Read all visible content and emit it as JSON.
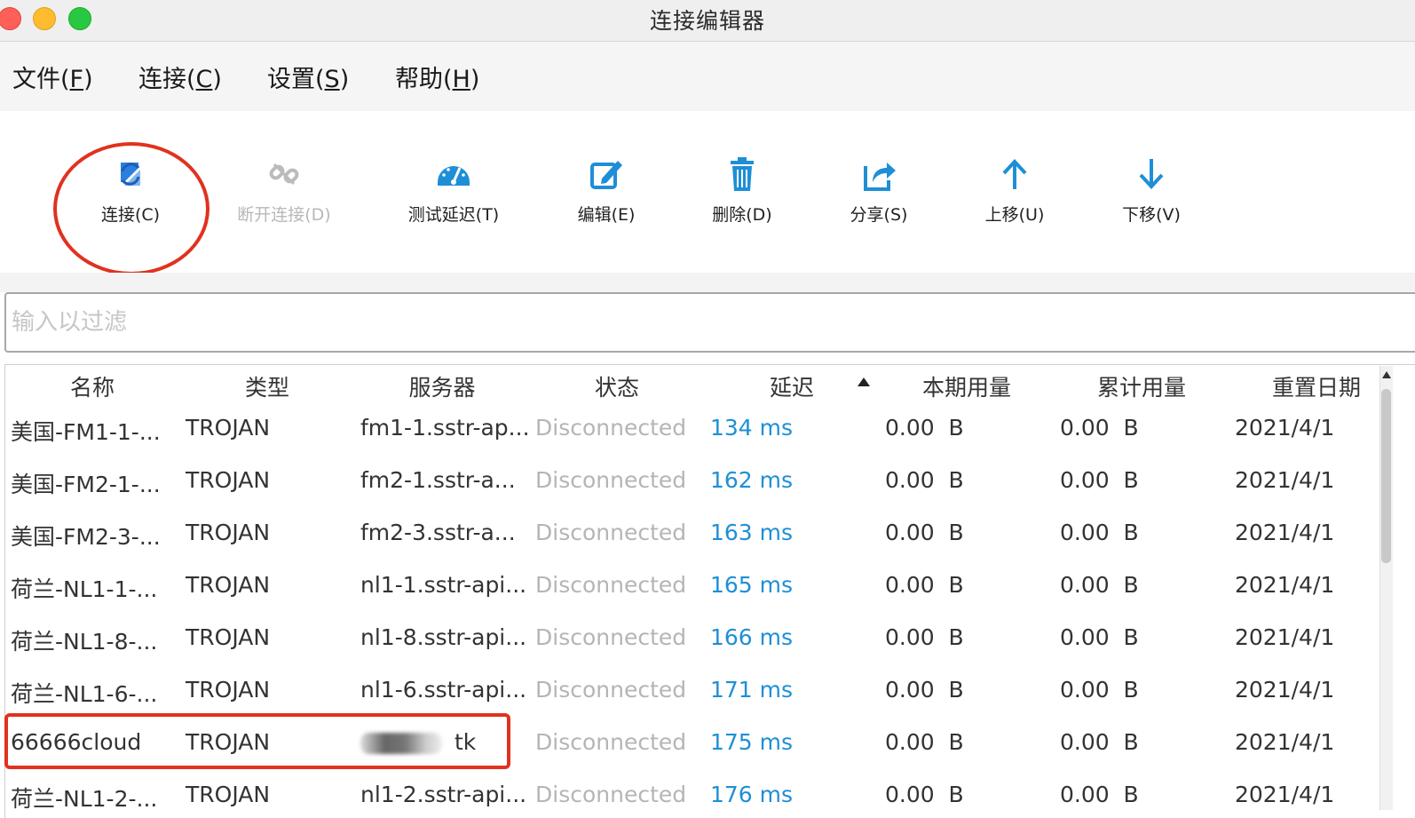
{
  "window": {
    "title": "连接编辑器"
  },
  "menu": [
    {
      "label": "文件(",
      "key": "F",
      "close": ")"
    },
    {
      "label": "连接(",
      "key": "C",
      "close": ")"
    },
    {
      "label": "设置(",
      "key": "S",
      "close": ")"
    },
    {
      "label": "帮助(",
      "key": "H",
      "close": ")"
    }
  ],
  "toolbar": {
    "connect": "连接(C)",
    "disconnect": "断开连接(D)",
    "test_latency": "测试延迟(T)",
    "edit": "编辑(E)",
    "delete": "删除(D)",
    "share": "分享(S)",
    "move_up": "上移(U)",
    "move_down": "下移(V)"
  },
  "filter": {
    "placeholder": "输入以过滤"
  },
  "table": {
    "columns": [
      "名称",
      "类型",
      "服务器",
      "状态",
      "延迟",
      "本期用量",
      "累计用量",
      "重置日期"
    ],
    "rows": [
      [
        "美国-FM1-1-...",
        "TROJAN",
        "fm1-1.sstr-ap...",
        "Disconnected",
        "134 ms",
        "0.00  B",
        "0.00  B",
        "2021/4/1"
      ],
      [
        "美国-FM2-1-...",
        "TROJAN",
        "fm2-1.sstr-a...",
        "Disconnected",
        "162 ms",
        "0.00  B",
        "0.00  B",
        "2021/4/1"
      ],
      [
        "美国-FM2-3-...",
        "TROJAN",
        "fm2-3.sstr-a...",
        "Disconnected",
        "163 ms",
        "0.00  B",
        "0.00  B",
        "2021/4/1"
      ],
      [
        "荷兰-NL1-1-...",
        "TROJAN",
        "nl1-1.sstr-api...",
        "Disconnected",
        "165 ms",
        "0.00  B",
        "0.00  B",
        "2021/4/1"
      ],
      [
        "荷兰-NL1-8-...",
        "TROJAN",
        "nl1-8.sstr-api...",
        "Disconnected",
        "166 ms",
        "0.00  B",
        "0.00  B",
        "2021/4/1"
      ],
      [
        "荷兰-NL1-6-...",
        "TROJAN",
        "nl1-6.sstr-api...",
        "Disconnected",
        "171 ms",
        "0.00  B",
        "0.00  B",
        "2021/4/1"
      ],
      [
        "66666cloud",
        "TROJAN",
        "tk",
        "Disconnected",
        "175 ms",
        "0.00  B",
        "0.00  B",
        "2021/4/1"
      ],
      [
        "荷兰-NL1-2-...",
        "TROJAN",
        "nl1-2.sstr-api...",
        "Disconnected",
        "176 ms",
        "0.00  B",
        "0.00  B",
        "2021/4/1"
      ]
    ]
  },
  "colors": {
    "accent": "#1e8fd6",
    "annotation": "#e0321f",
    "disabled": "#b8b8b8"
  },
  "icons": [
    "connect-icon",
    "disconnect-icon",
    "speedometer-icon",
    "edit-icon",
    "trash-icon",
    "share-icon",
    "arrow-up-icon",
    "arrow-down-icon"
  ]
}
